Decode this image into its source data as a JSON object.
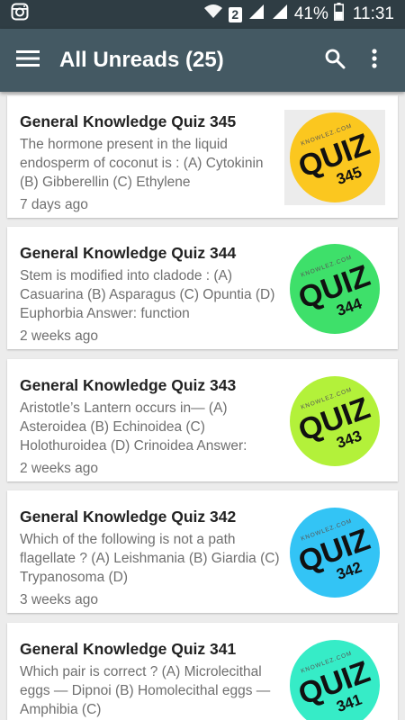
{
  "status_bar": {
    "battery": "41%",
    "time": "11:31",
    "sim": "2"
  },
  "app_bar": {
    "title": "All Unreads (25)"
  },
  "colors": {
    "status_bar": "#2f3d44",
    "app_bar": "#445963",
    "background": "#ececec"
  },
  "icons": {
    "menu": "hamburger-menu-icon",
    "search": "search-icon",
    "overflow": "more-vert-icon",
    "status_left": "instagram-icon",
    "wifi": "wifi-icon",
    "signal": "signal-icon",
    "battery": "battery-icon"
  },
  "articles": [
    {
      "title": "General Knowledge Quiz 345",
      "excerpt": "The hormone present in the liquid endosperm of coconut is : (A) Cytokinin (B) Gibberellin (C) Ethylene",
      "time": "7 days ago",
      "thumb_word": "QUIZ",
      "thumb_number": "345",
      "thumb_watermark": "KNOWLEZ.COM",
      "thumb_color": "#fbc71f",
      "thumb_bg": "#ececec"
    },
    {
      "title": "General Knowledge Quiz 344",
      "excerpt": "Stem is modified into cladode : (A) Casuarina (B) Asparagus (C) Opuntia (D) Euphorbia Answer: function",
      "time": "2 weeks ago",
      "thumb_word": "QUIZ",
      "thumb_number": "344",
      "thumb_watermark": "KNOWLEZ.COM",
      "thumb_color": "#3ee06a",
      "thumb_bg": "#ffffff"
    },
    {
      "title": "General Knowledge Quiz 343",
      "excerpt": "Aristotle’s Lantern occurs in— (A) Asteroidea (B) Echinoidea (C) Holothuroidea (D) Crinoidea Answer:",
      "time": "2 weeks ago",
      "thumb_word": "QUIZ",
      "thumb_number": "343",
      "thumb_watermark": "KNOWLEZ.COM",
      "thumb_color": "#b3f13a",
      "thumb_bg": "#ffffff"
    },
    {
      "title": "General Knowledge Quiz 342",
      "excerpt": "Which of the following is not a path flagellate ? (A) Leishmania (B) Giardia (C) Trypanosoma (D)",
      "time": "3 weeks ago",
      "thumb_word": "QUIZ",
      "thumb_number": "342",
      "thumb_watermark": "KNOWLEZ.COM",
      "thumb_color": "#33c4f5",
      "thumb_bg": "#ffffff"
    },
    {
      "title": "General Knowledge Quiz 341",
      "excerpt": "Which pair is correct ? (A) Microlecithal eggs — Dipnoi (B) Homolecithal eggs — Amphibia (C)",
      "time": "",
      "thumb_word": "QUIZ",
      "thumb_number": "341",
      "thumb_watermark": "KNOWLEZ.COM",
      "thumb_color": "#36ecc7",
      "thumb_bg": "#ffffff"
    }
  ]
}
